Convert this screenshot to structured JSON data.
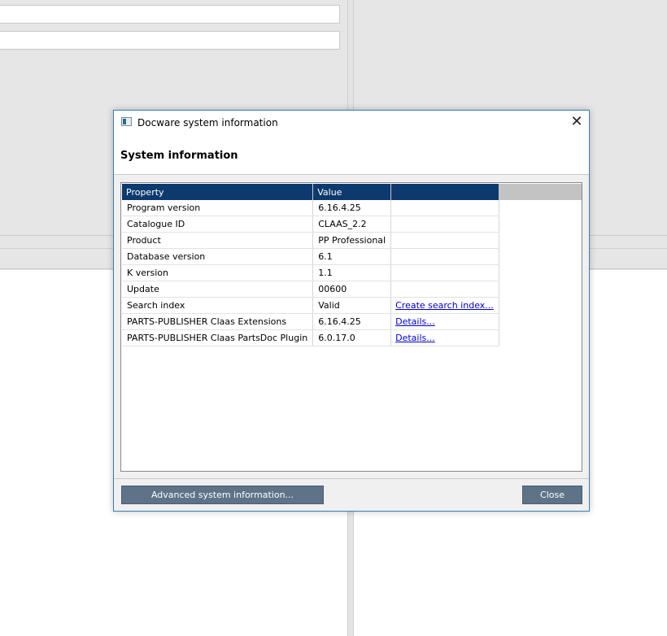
{
  "dialog": {
    "title": "Docware system information",
    "heading": "System information",
    "close_glyph": "✕",
    "app_icon": "docware-app-icon"
  },
  "table": {
    "headers": [
      "Property",
      "Value",
      ""
    ],
    "rows": [
      {
        "property": "Program version",
        "value": "6.16.4.25",
        "action": ""
      },
      {
        "property": "Catalogue ID",
        "value": "CLAAS_2.2",
        "action": ""
      },
      {
        "property": "Product",
        "value": "PP Professional",
        "action": ""
      },
      {
        "property": "Database version",
        "value": "6.1",
        "action": ""
      },
      {
        "property": "K version",
        "value": "1.1",
        "action": ""
      },
      {
        "property": "Update",
        "value": "00600",
        "action": ""
      },
      {
        "property": "Search index",
        "value": "Valid",
        "action": "Create search index..."
      },
      {
        "property": "PARTS-PUBLISHER Claas Extensions",
        "value": "6.16.4.25",
        "action": "Details..."
      },
      {
        "property": "PARTS-PUBLISHER Claas PartsDoc Plugin",
        "value": "6.0.17.0",
        "action": "Details..."
      }
    ]
  },
  "buttons": {
    "advanced": "Advanced system information...",
    "close": "Close"
  },
  "colors": {
    "table_header": "#0d3a6e",
    "button": "#5e7388",
    "link": "#0000cc",
    "dialog_border": "#3c7fb1"
  }
}
